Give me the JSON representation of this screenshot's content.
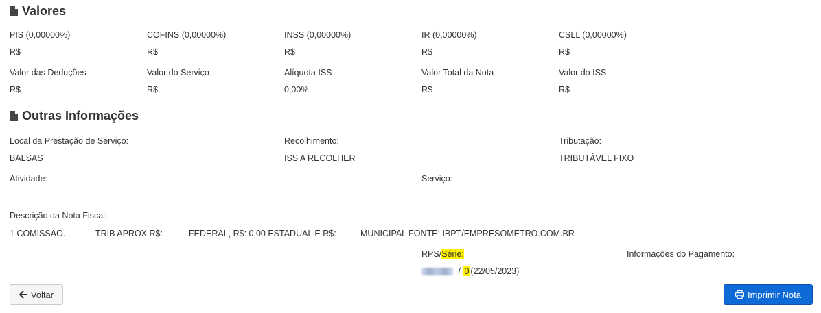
{
  "valores": {
    "title": "Valores",
    "row1": [
      {
        "label": "PIS (0,00000%)",
        "value": "R$"
      },
      {
        "label": "COFINS (0,00000%)",
        "value": "R$"
      },
      {
        "label": "INSS (0,00000%)",
        "value": "R$"
      },
      {
        "label": "IR (0,00000%)",
        "value": "R$"
      },
      {
        "label": "CSLL (0,00000%)",
        "value": "R$"
      }
    ],
    "row2": [
      {
        "label": "Valor das Deduções",
        "value": "R$"
      },
      {
        "label": "Valor do Serviço",
        "value": "R$"
      },
      {
        "label": "Alíquota ISS",
        "value": "0,00%"
      },
      {
        "label": "Valor Total da Nota",
        "value": "R$"
      },
      {
        "label": "Valor do ISS",
        "value": "R$"
      }
    ]
  },
  "outras": {
    "title": "Outras Informações",
    "local_label": "Local da Prestação de Serviço:",
    "local_value": "BALSAS",
    "recolhimento_label": "Recolhimento:",
    "recolhimento_value": "ISS A RECOLHER",
    "tributacao_label": "Tributação:",
    "tributacao_value": "TRIBUTÁVEL FIXO",
    "atividade_label": "Atividade:",
    "servico_label": "Serviço:",
    "descricao_label": "Descrição da Nota Fiscal:",
    "descricao_parts": [
      "1 COMISSAO.",
      "TRIB APROX R$:",
      "FEDERAL, R$: 0,00 ESTADUAL E R$:",
      "MUNICIPAL FONTE: IBPT/EMPRESOMETRO.COM.BR"
    ],
    "rps_label_a": "RPS/",
    "rps_label_b": "Série:",
    "rps_sep": "/",
    "rps_serie": "0",
    "rps_date": "(22/05/2023)",
    "pagamento_label": "Informações do Pagamento:"
  },
  "buttons": {
    "back_label": "Voltar",
    "print_label": "Imprimir Nota"
  },
  "icons": {
    "section": "file-icon",
    "back": "arrow-left-icon",
    "print": "printer-icon"
  }
}
